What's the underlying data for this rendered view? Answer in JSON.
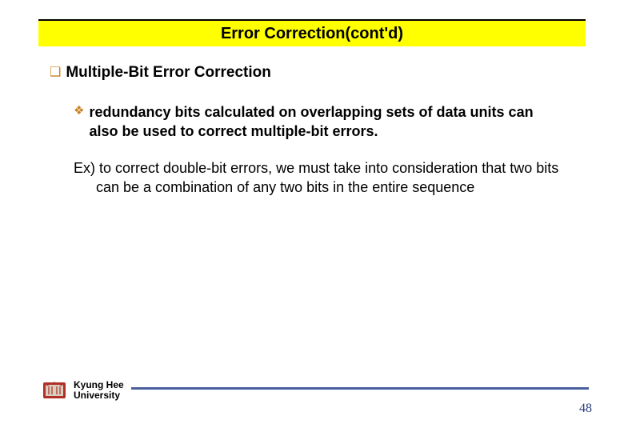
{
  "title": "Error Correction(cont'd)",
  "heading": "Multiple-Bit Error Correction",
  "sub": "redundancy bits calculated on overlapping sets of data units can also be used to correct multiple-bit errors.",
  "example": "Ex) to correct double-bit errors, we must take into consideration that two bits can be a combination of any two bits in the entire sequence",
  "footer": {
    "line1": "Kyung Hee",
    "line2": "University"
  },
  "page": "48"
}
